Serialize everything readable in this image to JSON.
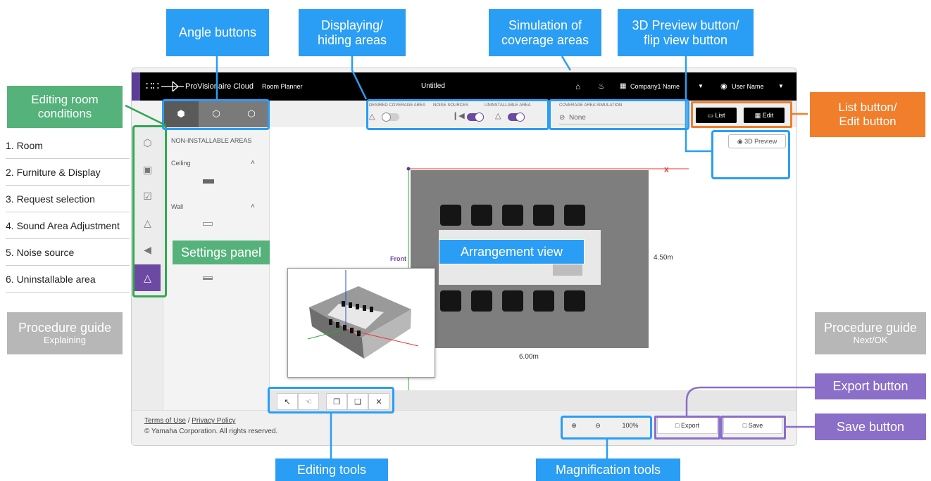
{
  "callouts": {
    "angle": "Angle buttons",
    "display_l1": "Displaying/",
    "display_l2": "hiding areas",
    "sim_l1": "Simulation of",
    "sim_l2": "coverage areas",
    "preview_l1": "3D Preview button/",
    "preview_l2": "flip view button",
    "editing_l1": "Editing room",
    "editing_l2": "conditions",
    "list_l1": "List button/",
    "list_l2": "Edit button",
    "settings": "Settings panel",
    "arrangement": "Arrangement view",
    "guide_left_l1": "Procedure guide",
    "guide_left_l2": "Explaining",
    "guide_right_l1": "Procedure guide",
    "guide_right_l2": "Next/OK",
    "export": "Export button",
    "save": "Save button",
    "editing_tools": "Editing tools",
    "magnification": "Magnification tools"
  },
  "steps": [
    "1. Room",
    "2. Furniture & Display",
    "3. Request selection",
    "4. Sound Area Adjustment",
    "5. Noise source",
    "6. Uninstallable area"
  ],
  "header": {
    "app_logo": "ProVisionaire Cloud",
    "app_module": "Room Planner",
    "doc_title": "Untitled",
    "company": "Company1 Name",
    "user": "User Name"
  },
  "toolbar": {
    "desired_coverage": "DESIRED COVERAGE AREA",
    "noise_sources": "NOISE SOURCES",
    "uninstallable": "UNINSTALLABLE AREA",
    "sim_label": "COVERAGE AREA SIMULATION",
    "sim_value": "None",
    "list_label": "List",
    "edit_label": "Edit",
    "preview_label": "3D Preview"
  },
  "toggles": {
    "desired_coverage": false,
    "noise_sources": true,
    "uninstallable": true
  },
  "panel": {
    "heading": "NON-INSTALLABLE AREAS",
    "ceiling": "Ceiling",
    "wall": "Wall"
  },
  "canvas": {
    "axis_x": "X",
    "width_dim": "6.00m",
    "depth_dim": "4.50m",
    "front_label": "Front"
  },
  "zoom": {
    "level": "100%"
  },
  "footer": {
    "terms": "Terms of Use",
    "sep": "/",
    "privacy": "Privacy Policy",
    "copyright": "© Yamaha Corporation. All rights reserved.",
    "export_label": "Export",
    "save_label": "Save"
  },
  "colors": {
    "callout_blue": "#2a9df4",
    "callout_green": "#55b27a",
    "callout_orange": "#f07e2b",
    "callout_purple": "#8b6ec8",
    "accent_purple": "#6c4aa3"
  }
}
